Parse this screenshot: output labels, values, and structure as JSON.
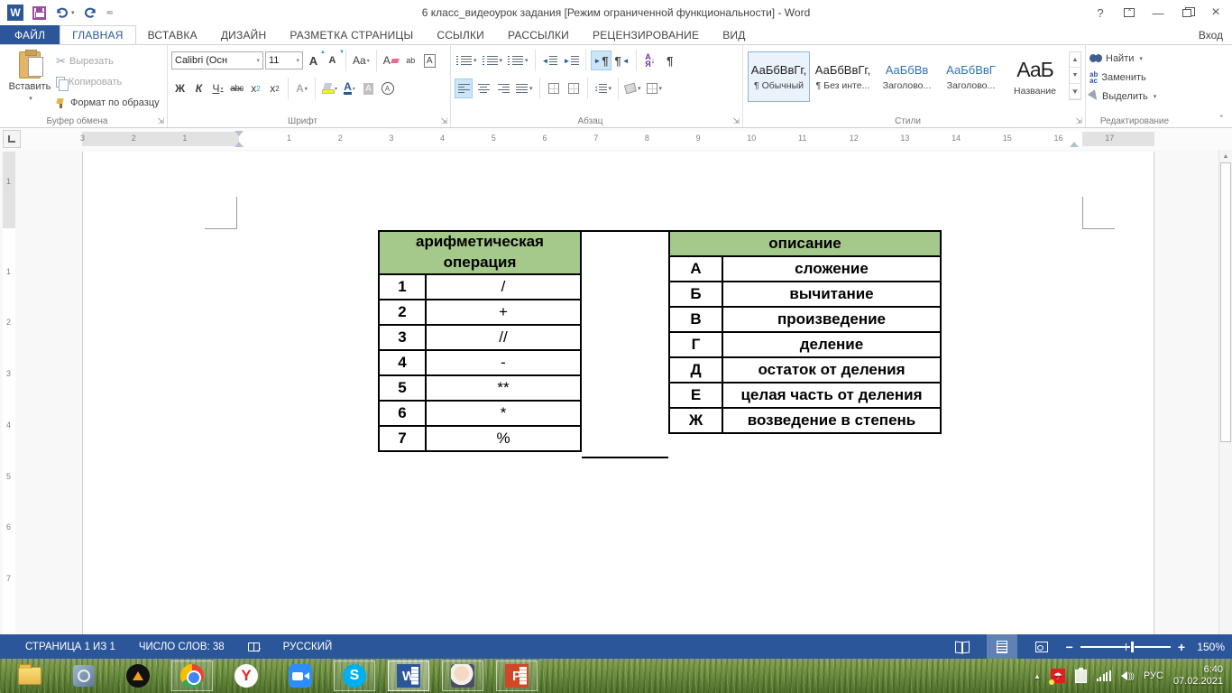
{
  "titlebar": {
    "title": "6 класс_видеоурок задания [Режим ограниченной функциональности] - Word",
    "help": "?",
    "signin": "Вход"
  },
  "tabs": [
    "ФАЙЛ",
    "ГЛАВНАЯ",
    "ВСТАВКА",
    "ДИЗАЙН",
    "РАЗМЕТКА СТРАНИЦЫ",
    "ССЫЛКИ",
    "РАССЫЛКИ",
    "РЕЦЕНЗИРОВАНИЕ",
    "ВИД"
  ],
  "ribbon": {
    "clipboard": {
      "label": "Буфер обмена",
      "paste": "Вставить",
      "cut": "Вырезать",
      "copy": "Копировать",
      "format_painter": "Формат по образцу"
    },
    "font": {
      "label": "Шрифт",
      "font_name": "Calibri (Осн",
      "font_size": "11",
      "bold": "Ж",
      "italic": "К",
      "underline": "Ч",
      "strike": "abc",
      "case_label": "Aa"
    },
    "paragraph": {
      "label": "Абзац"
    },
    "styles": {
      "label": "Стили",
      "items": [
        {
          "preview": "АаБбВвГг,",
          "name": "¶ Обычный",
          "selected": true,
          "color": "#222222",
          "big": false
        },
        {
          "preview": "АаБбВвГг,",
          "name": "¶ Без инте...",
          "selected": false,
          "color": "#222222",
          "big": false
        },
        {
          "preview": "АаБбВв",
          "name": "Заголово...",
          "selected": false,
          "color": "#2E74B5",
          "big": false
        },
        {
          "preview": "АаБбВвГ",
          "name": "Заголово...",
          "selected": false,
          "color": "#2E74B5",
          "big": false
        },
        {
          "preview": "АаБ",
          "name": "Название",
          "selected": false,
          "color": "#222222",
          "big": true
        }
      ]
    },
    "editing": {
      "label": "Редактирование",
      "find": "Найти",
      "replace": "Заменить",
      "select": "Выделить"
    }
  },
  "ruler": {
    "left_numbers": [
      "3",
      "2",
      "1"
    ],
    "main_numbers": [
      "1",
      "2",
      "3",
      "4",
      "5",
      "6",
      "7",
      "8",
      "9",
      "10",
      "11",
      "12",
      "13",
      "14",
      "15",
      "16",
      "17"
    ],
    "vertical_numbers": [
      "1",
      "1",
      "2",
      "3",
      "4",
      "5",
      "6",
      "7"
    ]
  },
  "document": {
    "left_table": {
      "header": "арифметическая операция",
      "header_line1": "арифметическая",
      "header_line2": "операция",
      "rows": [
        [
          "1",
          "/"
        ],
        [
          "2",
          "+"
        ],
        [
          "3",
          "//"
        ],
        [
          "4",
          "-"
        ],
        [
          "5",
          "**"
        ],
        [
          "6",
          "*"
        ],
        [
          "7",
          "%"
        ]
      ]
    },
    "right_table": {
      "header": "описание",
      "rows": [
        [
          "А",
          "сложение"
        ],
        [
          "Б",
          "вычитание"
        ],
        [
          "В",
          "произведение"
        ],
        [
          "Г",
          "деление"
        ],
        [
          "Д",
          "остаток от деления"
        ],
        [
          "Е",
          "целая часть от деления"
        ],
        [
          "Ж",
          "возведение в степень"
        ]
      ]
    }
  },
  "statusbar": {
    "page": "СТРАНИЦА 1 ИЗ 1",
    "words": "ЧИСЛО СЛОВ: 38",
    "language": "РУССКИЙ",
    "zoom": "150%"
  },
  "taskbar": {
    "items": [
      {
        "icon": "explorer-icon",
        "state": ""
      },
      {
        "icon": "kmplayer-icon",
        "state": ""
      },
      {
        "icon": "aimp-icon",
        "state": ""
      },
      {
        "icon": "chrome-icon",
        "state": "running"
      },
      {
        "icon": "yandex-icon",
        "state": "",
        "glyph": "Y"
      },
      {
        "icon": "zoom-app-icon",
        "state": ""
      },
      {
        "icon": "skype-icon",
        "state": "running",
        "glyph": "S"
      },
      {
        "icon": "word-icon",
        "state": "active",
        "glyph": "W"
      },
      {
        "icon": "avatar-icon",
        "state": "running"
      },
      {
        "icon": "powerpoint-icon",
        "state": "running",
        "glyph": "P"
      }
    ],
    "tray": {
      "lang": "РУС",
      "time": "6:40",
      "date": "07.02.2021"
    }
  },
  "colors": {
    "accent": "#2B579A",
    "table_header_green": "#A5C98A",
    "heading_blue": "#2E74B5"
  }
}
